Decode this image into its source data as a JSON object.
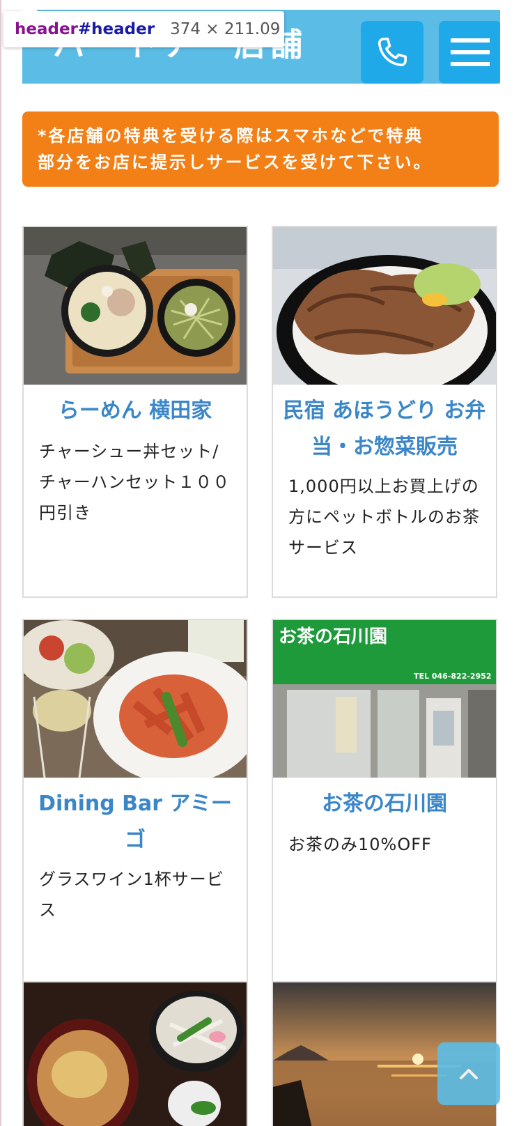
{
  "devtools": {
    "tag": "header",
    "id": "#header",
    "size": "374 × 211.09"
  },
  "header": {
    "title": "パートナー店舗"
  },
  "notice": {
    "line1": "*各店舗の特典を受ける際はスマホなどで特典",
    "line2": "部分をお店に提示しサービスを受けて下さい。"
  },
  "shops": [
    {
      "name": "らーめん 横田家",
      "benefit": "チャーシュー丼セット/チャーハンセット１００円引き",
      "photo_icon": "ramen-photo"
    },
    {
      "name": "民宿 あほうどり お弁当・お惣菜販売",
      "benefit": "1,000円以上お買上げの方にペットボトルのお茶サービス",
      "photo_icon": "bento-photo"
    },
    {
      "name": "Dining Bar アミーゴ",
      "benefit": "グラスワイン1杯サービス",
      "photo_icon": "pasta-photo"
    },
    {
      "name": "お茶の石川園",
      "benefit": "お茶のみ10%OFF",
      "photo_icon": "tea-shop-photo",
      "sign_text": "お茶の石川園",
      "sign_tel": "TEL 046-822-2952"
    },
    {
      "photo_icon": "katsudon-photo"
    },
    {
      "photo_icon": "sunset-photo"
    }
  ],
  "colors": {
    "header_bg": "#5bbde6",
    "button_bg": "#20a9e8",
    "notice_bg": "#f28016",
    "title_text": "#3a86c8"
  }
}
